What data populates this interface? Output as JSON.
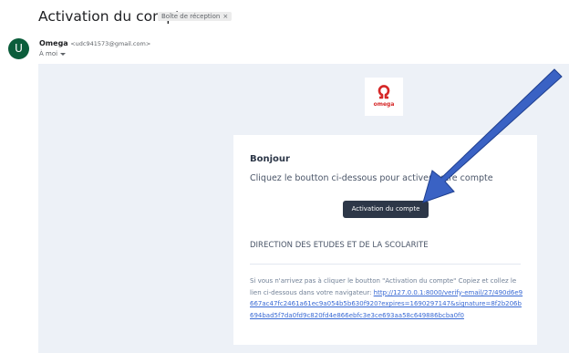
{
  "email": {
    "subject": "Activation du compte",
    "label": "Boîte de réception",
    "label_close_glyph": "×",
    "avatar_letter": "U",
    "sender_name": "Omega",
    "sender_email": "<udc941573@gmail.com>",
    "to": "À moi"
  },
  "body": {
    "logo_text": "omega",
    "greeting": "Bonjour",
    "instruction": "Cliquez le boutton ci-dessous pour activer votre compte",
    "button_label": "Activation du compte",
    "department": "DIRECTION DES ETUDES ET DE LA SCOLARITE",
    "footer_text": "Si vous n'arrivez pas à cliquer le boutton \"Activation du compte\" Copiez et collez le lien ci-dessous dans votre navigateur: ",
    "verify_link": "http://127.0.0.1:8000/verify-email/27/490d6e9667ac47fc2461a61ec9a054b5b630f920?expires=1690297147&signature=8f2b206b694bad5f7da0fd9c820fd4e866ebfc3e3ce693aa58c649886bcba0f0"
  },
  "colors": {
    "avatar": "#0b5d3b",
    "button": "#2d3748",
    "arrow": "#3a62c4",
    "mail_background": "#edf1f7",
    "logo": "#d62828"
  },
  "icons": {
    "logo": "omega-logo-icon",
    "arrow": "annotation-arrow"
  }
}
